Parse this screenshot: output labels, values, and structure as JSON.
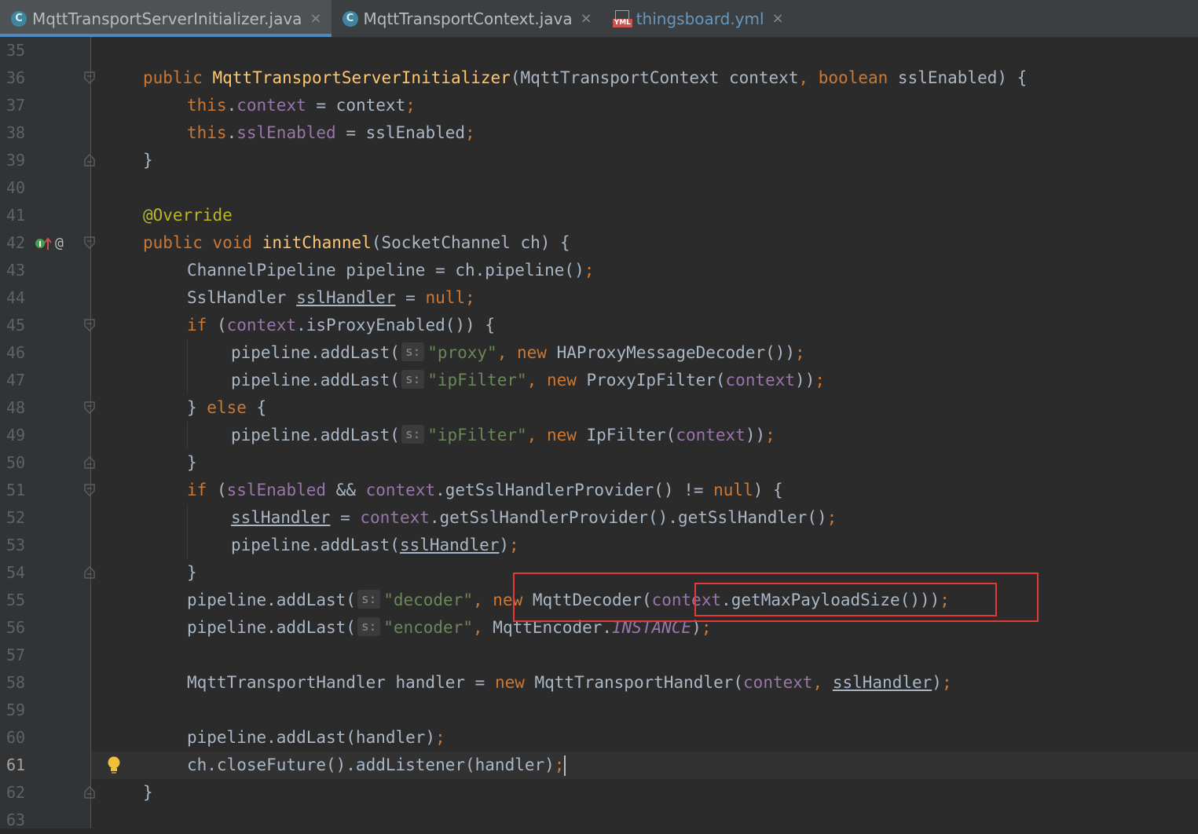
{
  "tabs": [
    {
      "label": "MqttTransportServerInitializer.java",
      "icon": "java-class-icon",
      "active": true
    },
    {
      "label": "MqttTransportContext.java",
      "icon": "java-class-icon",
      "active": false
    },
    {
      "label": "thingsboard.yml",
      "icon": "yml-file-icon",
      "active": false
    }
  ],
  "editor": {
    "current_line": "61",
    "line_numbers": [
      "35",
      "36",
      "37",
      "38",
      "39",
      "40",
      "41",
      "42",
      "43",
      "44",
      "45",
      "46",
      "47",
      "48",
      "49",
      "50",
      "51",
      "52",
      "53",
      "54",
      "55",
      "56",
      "57",
      "58",
      "59",
      "60",
      "61",
      "62",
      "63"
    ],
    "param_hint": "s:",
    "code": {
      "l36": [
        "public",
        " ",
        "MqttTransportServerInitializer",
        "(MqttTransportContext context",
        ", ",
        "boolean",
        " sslEnabled) {"
      ],
      "l37": [
        "this",
        ".",
        "context",
        " = context",
        ";"
      ],
      "l38": [
        "this",
        ".",
        "sslEnabled",
        " = sslEnabled",
        ";"
      ],
      "l39": "}",
      "l41": "@Override",
      "l42": [
        "public void",
        " ",
        "initChannel",
        "(SocketChannel ch) {"
      ],
      "l43": [
        "ChannelPipeline pipeline = ch.pipeline()",
        ";"
      ],
      "l44": [
        "SslHandler ",
        "sslHandler",
        " = ",
        "null",
        ";"
      ],
      "l45": [
        "if",
        " (",
        "context",
        ".isProxyEnabled()) {"
      ],
      "l46": [
        "pipeline.addLast(",
        "\"proxy\"",
        ", ",
        "new",
        " HAProxyMessageDecoder())",
        ";"
      ],
      "l47": [
        "pipeline.addLast(",
        "\"ipFilter\"",
        ", ",
        "new",
        " ProxyIpFilter(",
        "context",
        "))",
        ";"
      ],
      "l48": [
        "} ",
        "else",
        " {"
      ],
      "l49": [
        "pipeline.addLast(",
        "\"ipFilter\"",
        ", ",
        "new",
        " IpFilter(",
        "context",
        "))",
        ";"
      ],
      "l50": "}",
      "l51": [
        "if",
        " (",
        "sslEnabled",
        " && ",
        "context",
        ".getSslHandlerProvider() != ",
        "null",
        ") {"
      ],
      "l52": [
        "sslHandler",
        " = ",
        "context",
        ".getSslHandlerProvider().getSslHandler()",
        ";"
      ],
      "l53": [
        "pipeline.addLast(",
        "sslHandler",
        ")",
        ";"
      ],
      "l54": "}",
      "l55": [
        "pipeline.addLast(",
        "\"decoder\"",
        ", ",
        "new",
        " MqttDecoder(",
        "context",
        ".getMaxPayloadSize()))",
        ";"
      ],
      "l56": [
        "pipeline.addLast(",
        "\"encoder\"",
        ", ",
        "MqttEncoder.",
        "INSTANCE",
        ")",
        ";"
      ],
      "l58": [
        "MqttTransportHandler handler = ",
        "new",
        " MqttTransportHandler(",
        "context",
        ", ",
        "sslHandler",
        ")",
        ";"
      ],
      "l60": [
        "pipeline.addLast(handler)",
        ";"
      ],
      "l61": [
        "ch.closeFuture().addListener(handler)",
        ";"
      ],
      "l62": "}"
    },
    "colors": {
      "background": "#2b2b2b",
      "keyword": "#cc7832",
      "method": "#ffc66d",
      "field": "#9876aa",
      "string": "#6a8759",
      "annotation": "#bbb529",
      "text": "#a9b7c6",
      "highlight_box": "#e03a3a"
    }
  }
}
